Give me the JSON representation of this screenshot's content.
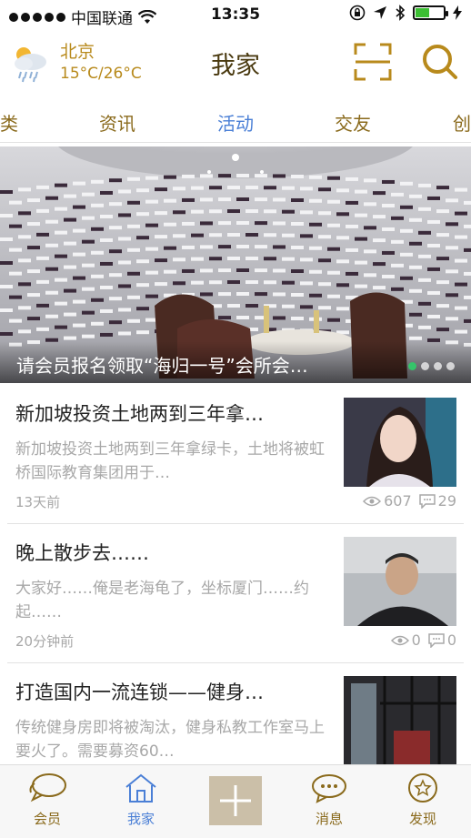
{
  "status_bar": {
    "carrier": "中国联通",
    "time": "13:35",
    "battery_level": 0.5
  },
  "header": {
    "city": "北京",
    "temperature": "15°C/26°C",
    "title": "我家",
    "icons": {
      "weather": "cloudy-rain-icon",
      "scan": "scan-icon",
      "search": "search-icon"
    }
  },
  "tabs": [
    {
      "label": "类",
      "active": false
    },
    {
      "label": "资讯",
      "active": false
    },
    {
      "label": "活动",
      "active": true
    },
    {
      "label": "交友",
      "active": false
    },
    {
      "label": "创",
      "active": false
    }
  ],
  "banner": {
    "caption": "请会员报名领取“海归一号”会所会…",
    "page_count": 4,
    "current_page": 1
  },
  "feed": [
    {
      "title": "新加坡投资土地两到三年拿…",
      "summary": "新加坡投资土地两到三年拿绿卡，土地将被虹桥国际教育集团用于…",
      "time": "13天前",
      "views": "607",
      "comments": "29"
    },
    {
      "title": "晚上散步去……",
      "summary": "大家好……俺是老海龟了，坐标厦门……约起……",
      "time": "20分钟前",
      "views": "0",
      "comments": "0"
    },
    {
      "title": "打造国内一流连锁——健身…",
      "summary": "传统健身房即将被淘汰，健身私教工作室马上要火了。需要募资60…",
      "time": "",
      "views": "",
      "comments": ""
    }
  ],
  "tabbar": [
    {
      "label": "会员",
      "icon": "chat-bubbles-icon",
      "active": false
    },
    {
      "label": "我家",
      "icon": "home-icon",
      "active": true
    },
    {
      "label": "",
      "icon": "plus-icon",
      "active": false
    },
    {
      "label": "消息",
      "icon": "message-icon",
      "active": false
    },
    {
      "label": "发现",
      "icon": "star-circle-icon",
      "active": false
    }
  ],
  "colors": {
    "accent_gold": "#b88a1c",
    "active_blue": "#4a7fd6",
    "muted_text": "#a8a8a8"
  }
}
